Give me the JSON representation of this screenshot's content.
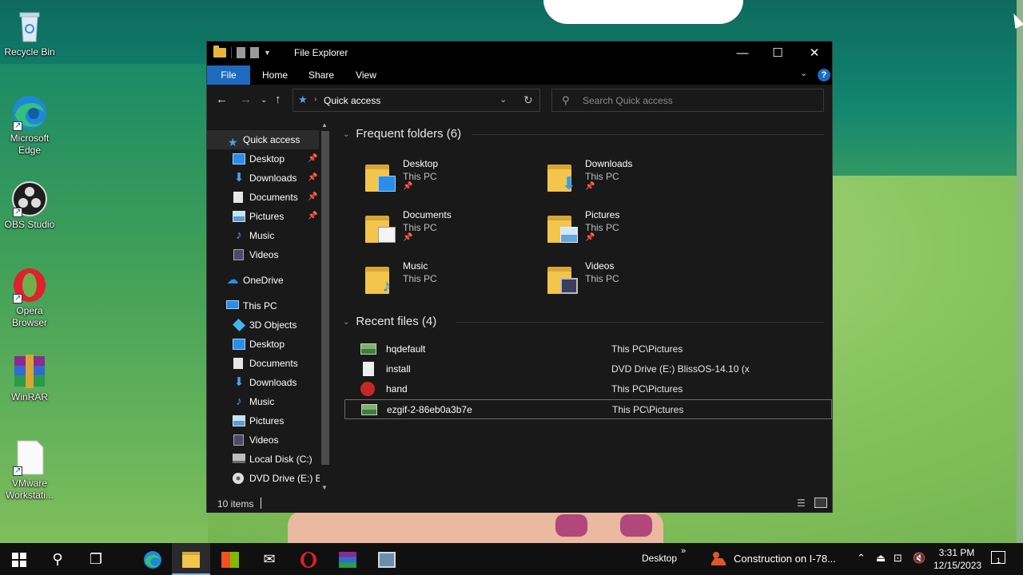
{
  "desktop": {
    "icons": [
      {
        "label": "Recycle Bin",
        "icon": "recycle-bin-icon"
      },
      {
        "label": "Microsoft Edge",
        "icon": "edge-icon"
      },
      {
        "label": "OBS Studio",
        "icon": "obs-icon"
      },
      {
        "label": "Opera Browser",
        "icon": "opera-icon"
      },
      {
        "label": "WinRAR",
        "icon": "winrar-icon"
      },
      {
        "label": "VMware Workstati...",
        "icon": "vmware-icon"
      }
    ]
  },
  "window": {
    "title": "File Explorer",
    "controls": {
      "minimize": "—",
      "maximize": "☐",
      "close": "✕"
    }
  },
  "ribbon": {
    "tabs": [
      "File",
      "Home",
      "Share",
      "View"
    ],
    "help": "?"
  },
  "address": {
    "path": "Quick access",
    "search_placeholder": "Search Quick access"
  },
  "navpane": {
    "items": [
      {
        "label": "Quick access",
        "icon": "star-icon",
        "pinned": false
      },
      {
        "label": "Desktop",
        "icon": "desktop-icon",
        "pinned": true
      },
      {
        "label": "Downloads",
        "icon": "download-icon",
        "pinned": true
      },
      {
        "label": "Documents",
        "icon": "documents-icon",
        "pinned": true
      },
      {
        "label": "Pictures",
        "icon": "pictures-icon",
        "pinned": true
      },
      {
        "label": "Music",
        "icon": "music-icon",
        "pinned": false
      },
      {
        "label": "Videos",
        "icon": "videos-icon",
        "pinned": false
      },
      {
        "label": "OneDrive",
        "icon": "onedrive-icon",
        "pinned": false
      },
      {
        "label": "This PC",
        "icon": "this-pc-icon",
        "pinned": false
      },
      {
        "label": "3D Objects",
        "icon": "3d-objects-icon",
        "pinned": false
      },
      {
        "label": "Desktop",
        "icon": "desktop-icon",
        "pinned": false
      },
      {
        "label": "Documents",
        "icon": "documents-icon",
        "pinned": false
      },
      {
        "label": "Downloads",
        "icon": "download-icon",
        "pinned": false
      },
      {
        "label": "Music",
        "icon": "music-icon",
        "pinned": false
      },
      {
        "label": "Pictures",
        "icon": "pictures-icon",
        "pinned": false
      },
      {
        "label": "Videos",
        "icon": "videos-icon",
        "pinned": false
      },
      {
        "label": "Local Disk (C:)",
        "icon": "local-disk-icon",
        "pinned": false
      },
      {
        "label": "DVD Drive (E:) Bl",
        "icon": "dvd-drive-icon",
        "pinned": false
      }
    ]
  },
  "frequent": {
    "header": "Frequent folders (6)",
    "folders": [
      {
        "name": "Desktop",
        "location": "This PC",
        "pinned": true
      },
      {
        "name": "Downloads",
        "location": "This PC",
        "pinned": true
      },
      {
        "name": "Documents",
        "location": "This PC",
        "pinned": true
      },
      {
        "name": "Pictures",
        "location": "This PC",
        "pinned": true
      },
      {
        "name": "Music",
        "location": "This PC",
        "pinned": false
      },
      {
        "name": "Videos",
        "location": "This PC",
        "pinned": false
      }
    ]
  },
  "recent": {
    "header": "Recent files (4)",
    "files": [
      {
        "name": "hqdefault",
        "location": "This PC\\Pictures",
        "icon": "image-file-icon"
      },
      {
        "name": "install",
        "location": "DVD Drive (E:) BlissOS-14.10 (x",
        "icon": "text-file-icon"
      },
      {
        "name": "hand",
        "location": "This PC\\Pictures",
        "icon": "image-file-icon"
      },
      {
        "name": "ezgif-2-86eb0a3b7e",
        "location": "This PC\\Pictures",
        "icon": "image-file-icon"
      }
    ]
  },
  "status": {
    "count": "10 items"
  },
  "taskbar": {
    "desktop_label": "Desktop",
    "news": "Construction on I-78...",
    "time": "3:31 PM",
    "date": "12/15/2023",
    "notification_count": "1"
  },
  "colors": {
    "accent": "#1c6bbf",
    "window_bg": "#191919",
    "titlebar_bg": "#000000",
    "folder": "#f2c54c",
    "taskbar_bg": "#101010"
  }
}
